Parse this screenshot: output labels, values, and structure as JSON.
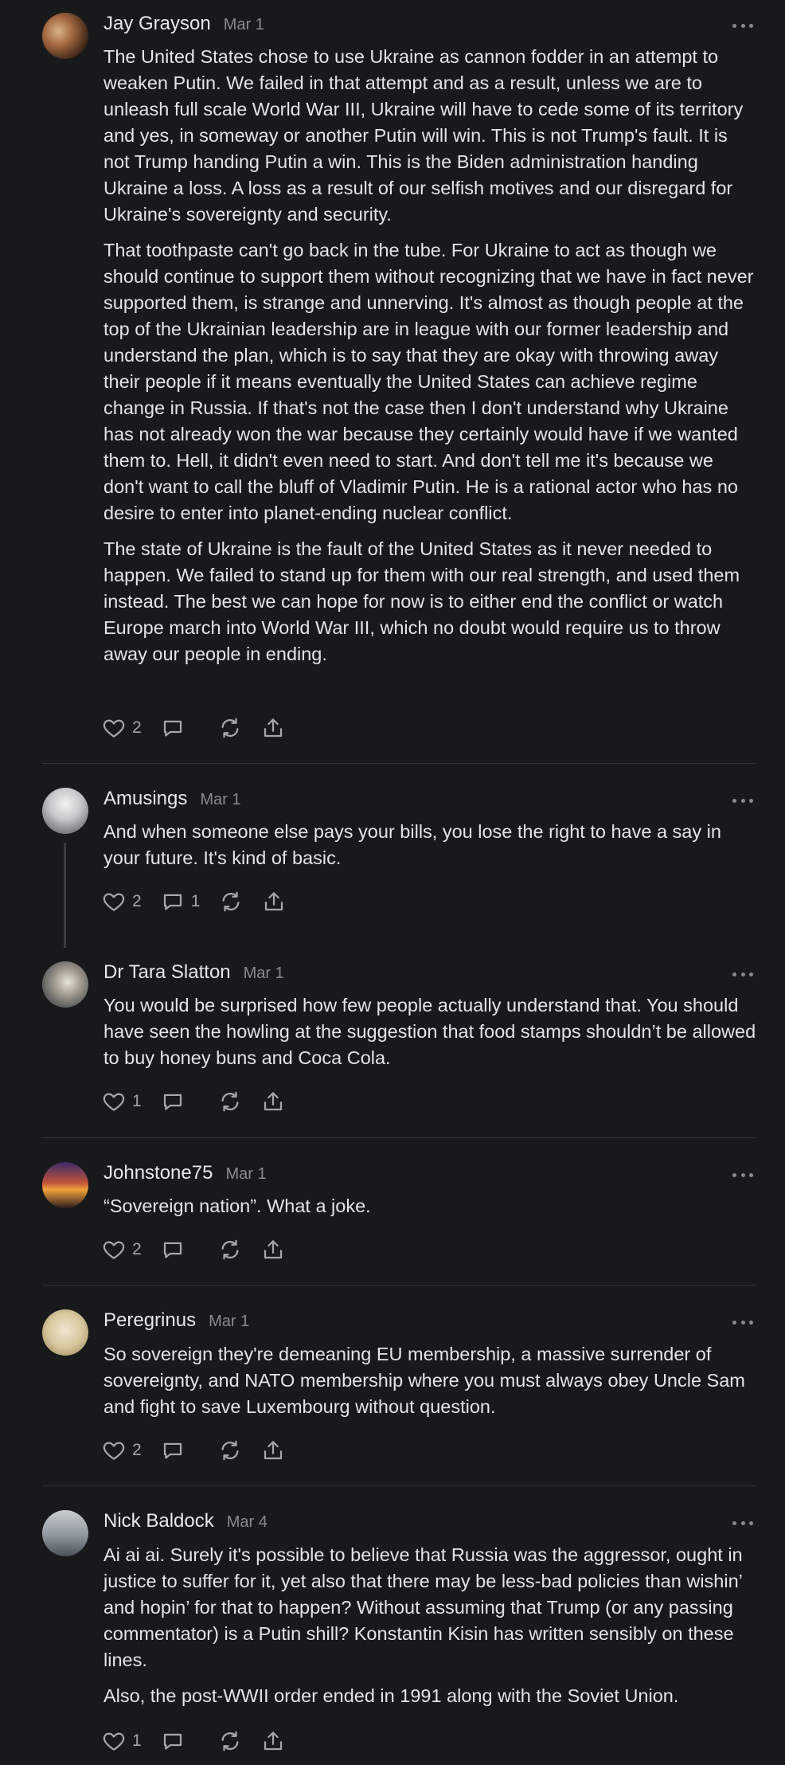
{
  "comments": [
    {
      "author": "Jay Grayson",
      "date": "Mar 1",
      "paragraphs": [
        "The United States chose to use Ukraine as cannon fodder in an attempt to weaken Putin. We failed in that attempt and as a result, unless we are to unleash full scale World War III, Ukraine will have to cede some of its territory and yes, in someway or another Putin will win. This is not Trump's fault. It is not Trump handing Putin a win. This is the Biden administration handing Ukraine a loss. A loss as a result of our selfish motives and our disregard for Ukraine's sovereignty and security.",
        "That toothpaste can't go back in the tube. For Ukraine to act as though we should continue to support them without recognizing that we have in fact never supported them, is strange and unnerving. It's almost as though people at the top of the Ukrainian leadership are in league with our former leadership and understand the plan, which is to say that they are okay with throwing away their people if it means eventually the United States can achieve regime change in Russia. If that's not the case then I don't understand why Ukraine has not already won the war because they certainly would have if we wanted them to. Hell, it didn't even need to start. And don't tell me it's because we don't want to call the bluff of Vladimir Putin. He is a rational actor who has no desire to enter into planet-ending nuclear conflict.",
        "The state of Ukraine is the fault of the United States as it never needed to happen. We failed to stand up for them with our real strength, and used them instead. The best we can hope for now is to either end the conflict or watch Europe march into World War III, which no doubt would require us to throw away our people in ending."
      ],
      "likes": "2",
      "replies": ""
    },
    {
      "author": "Amusings",
      "date": "Mar 1",
      "paragraphs": [
        "And when someone else pays your bills, you lose the right to have a say in your future. It's kind of basic."
      ],
      "likes": "2",
      "replies": "1"
    },
    {
      "author": "Dr Tara Slatton",
      "date": "Mar 1",
      "paragraphs": [
        "You would be surprised how few people actually understand that. You should have seen the howling at the suggestion that food stamps shouldn’t be allowed to buy honey buns and Coca Cola."
      ],
      "likes": "1",
      "replies": ""
    },
    {
      "author": "Johnstone75",
      "date": "Mar 1",
      "paragraphs": [
        "“Sovereign nation”. What a joke."
      ],
      "likes": "2",
      "replies": ""
    },
    {
      "author": "Peregrinus",
      "date": "Mar 1",
      "paragraphs": [
        "So sovereign they're demeaning EU membership, a massive surrender of sovereignty, and NATO membership where you must always obey Uncle Sam and fight to save Luxembourg without question."
      ],
      "likes": "2",
      "replies": ""
    },
    {
      "author": "Nick Baldock",
      "date": "Mar 4",
      "paragraphs": [
        "Ai ai ai. Surely it's possible to believe that Russia was the aggressor, ought in justice to suffer for it, yet also that there may be less-bad policies than wishin’ and hopin’ for that to happen? Without assuming that Trump (or any passing commentator) is a Putin shill? Konstantin Kisin has written sensibly on these lines.",
        "Also, the post-WWII order ended in 1991 along with the Soviet Union."
      ],
      "likes": "1",
      "replies": ""
    }
  ],
  "icons": {
    "like": "heart-icon",
    "reply": "speech-bubble-icon",
    "restack": "restack-arrows-icon",
    "share": "share-upload-icon",
    "more": "more-dots-icon"
  }
}
